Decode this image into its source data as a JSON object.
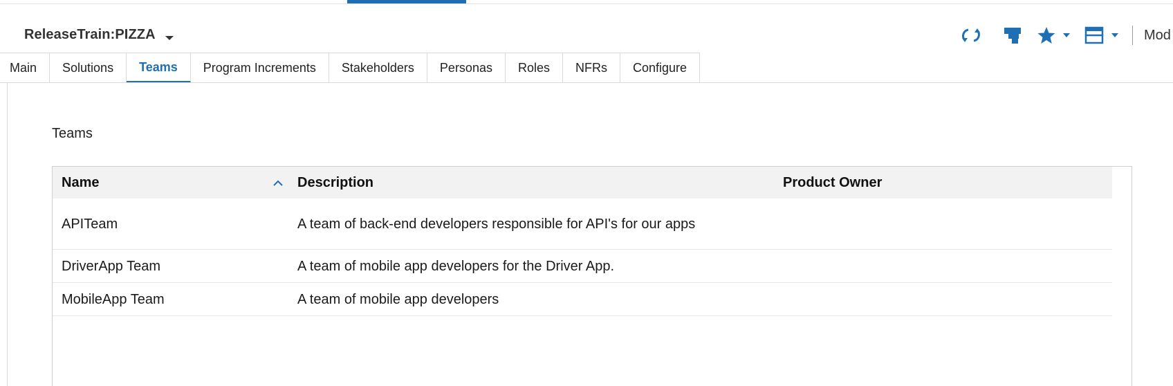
{
  "header": {
    "title": "ReleaseTrain:PIZZA"
  },
  "toolbar": {
    "more_label": "Mod",
    "icons": [
      "refresh-icon",
      "dashboard-icon",
      "star-icon",
      "layout-icon"
    ],
    "accent_color": "#1f6fb5"
  },
  "tabs": [
    {
      "label": "Main",
      "active": false
    },
    {
      "label": "Solutions",
      "active": false
    },
    {
      "label": "Teams",
      "active": true
    },
    {
      "label": "Program Increments",
      "active": false
    },
    {
      "label": "Stakeholders",
      "active": false
    },
    {
      "label": "Personas",
      "active": false
    },
    {
      "label": "Roles",
      "active": false
    },
    {
      "label": "NFRs",
      "active": false
    },
    {
      "label": "Configure",
      "active": false
    }
  ],
  "section": {
    "label": "Teams"
  },
  "table": {
    "columns": [
      "Name",
      "Description",
      "Product Owner"
    ],
    "sort": {
      "column": "Name",
      "direction": "ascending"
    },
    "rows": [
      {
        "name": "APITeam",
        "description": "A team of back-end developers responsible for API's for our apps",
        "product_owner": ""
      },
      {
        "name": "DriverApp Team",
        "description": "A team of mobile app developers for the Driver App.",
        "product_owner": ""
      },
      {
        "name": "MobileApp Team",
        "description": "A team of mobile app developers",
        "product_owner": ""
      }
    ]
  }
}
